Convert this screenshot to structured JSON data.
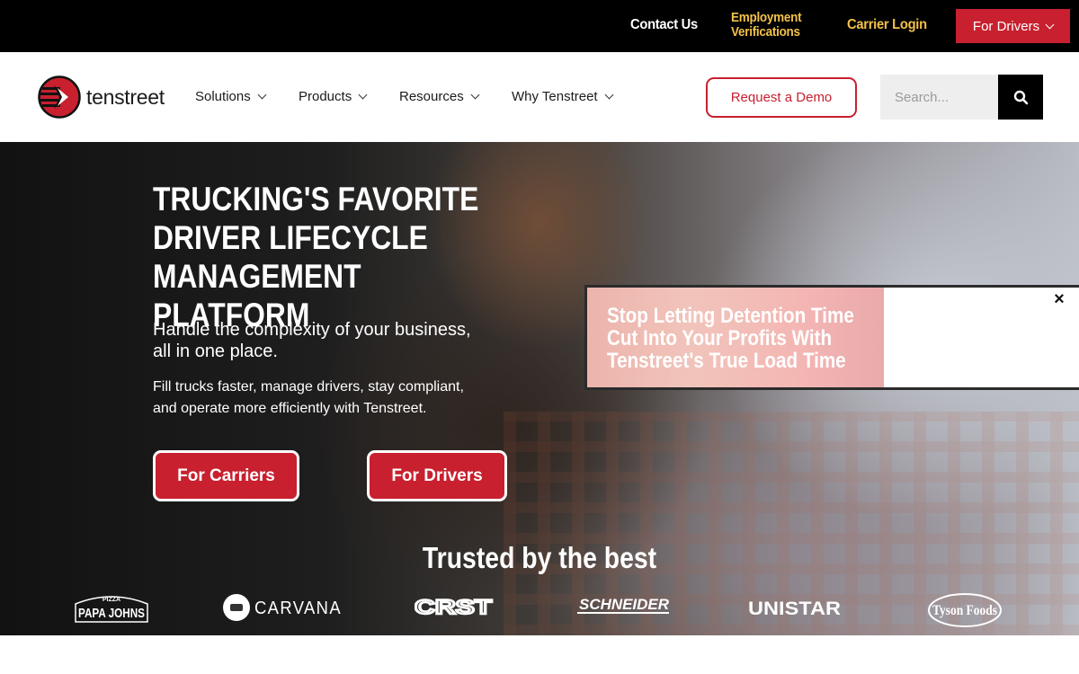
{
  "topbar": {
    "contact": "Contact Us",
    "employment_line1": "Employment",
    "employment_line2": "Verifications",
    "carrier_login": "Carrier Login",
    "for_drivers": "For Drivers"
  },
  "header": {
    "logo_text": "tenstreet",
    "nav": [
      {
        "label": "Solutions"
      },
      {
        "label": "Products"
      },
      {
        "label": "Resources"
      },
      {
        "label": "Why Tenstreet"
      }
    ],
    "demo_label": "Request a Demo",
    "search_placeholder": "Search..."
  },
  "hero": {
    "title_lines": [
      "TRUCKING'S FAVORITE",
      "DRIVER LIFECYCLE",
      "MANAGEMENT PLATFORM"
    ],
    "subtitle_lines": [
      "Handle the complexity of your business,",
      "all in one place."
    ],
    "description_lines": [
      "Fill trucks faster, manage drivers, stay compliant,",
      "and operate more efficiently with Tenstreet."
    ],
    "cta_carriers": "For Carriers",
    "cta_drivers": "For Drivers",
    "trusted_heading": "Trusted by the best"
  },
  "brands": [
    {
      "name": "PAPA JOHNS",
      "small": "PIZZA"
    },
    {
      "name": "CARVANA"
    },
    {
      "name": "CRST"
    },
    {
      "name": "SCHNEIDER"
    },
    {
      "name": "UNISTAR"
    },
    {
      "name": "Tyson Foods"
    }
  ],
  "promo": {
    "lines": [
      "Stop Letting Detention Time",
      "Cut Into Your Profits With",
      "Tenstreet's True Load Time"
    ],
    "close": "×"
  },
  "colors": {
    "brand_red": "#c8202f",
    "accent_yellow": "#f2c14a",
    "topbar_bg": "#000000"
  }
}
